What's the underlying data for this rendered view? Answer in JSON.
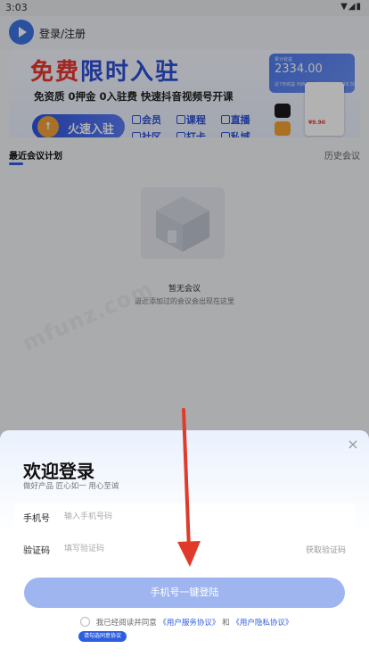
{
  "status_bar": {
    "time": "3:03",
    "icons": "▼◢▮"
  },
  "header": {
    "login_label": "登录/注册"
  },
  "banner": {
    "title_hot": "免费",
    "title_rest": "限时入驻",
    "subtitle": "免资质 0押金 0入驻费 快速抖音视频号开课",
    "cta_label": "火速入驻",
    "features": [
      "会员",
      "课程",
      "直播",
      "社区",
      "打卡",
      "私域"
    ],
    "earnings_label": "累计收益",
    "earnings_value": "2334.00",
    "earnings_row": "近7天收益 ¥98.00  · 待结算收益 ¥18.30",
    "product_price": "¥9.90"
  },
  "tabs": {
    "recent": "最近会议计划",
    "history": "历史会议"
  },
  "empty_state": {
    "title": "暂无会议",
    "subtitle": "最近添加过的会议会出现在这里"
  },
  "watermark": "mfunz.com",
  "login_sheet": {
    "title": "欢迎登录",
    "slogan": "做好产品 匠心如一 用心至诚",
    "phone_label": "手机号",
    "phone_placeholder": "输入手机号码",
    "code_label": "验证码",
    "code_placeholder": "填写验证码",
    "get_code": "获取验证码",
    "submit": "手机号一键登陆",
    "agree_prefix": "我已经阅读并同意",
    "service_agreement": "《用户服务协议》",
    "agree_and": "和",
    "privacy_agreement": "《用户隐私协议》",
    "agree_tip": "请勾选同意协议"
  },
  "colors": {
    "accent": "#2e5ee0",
    "button": "#9fb5ef",
    "hot": "#e8372e",
    "annotation": "#e03a2a"
  }
}
